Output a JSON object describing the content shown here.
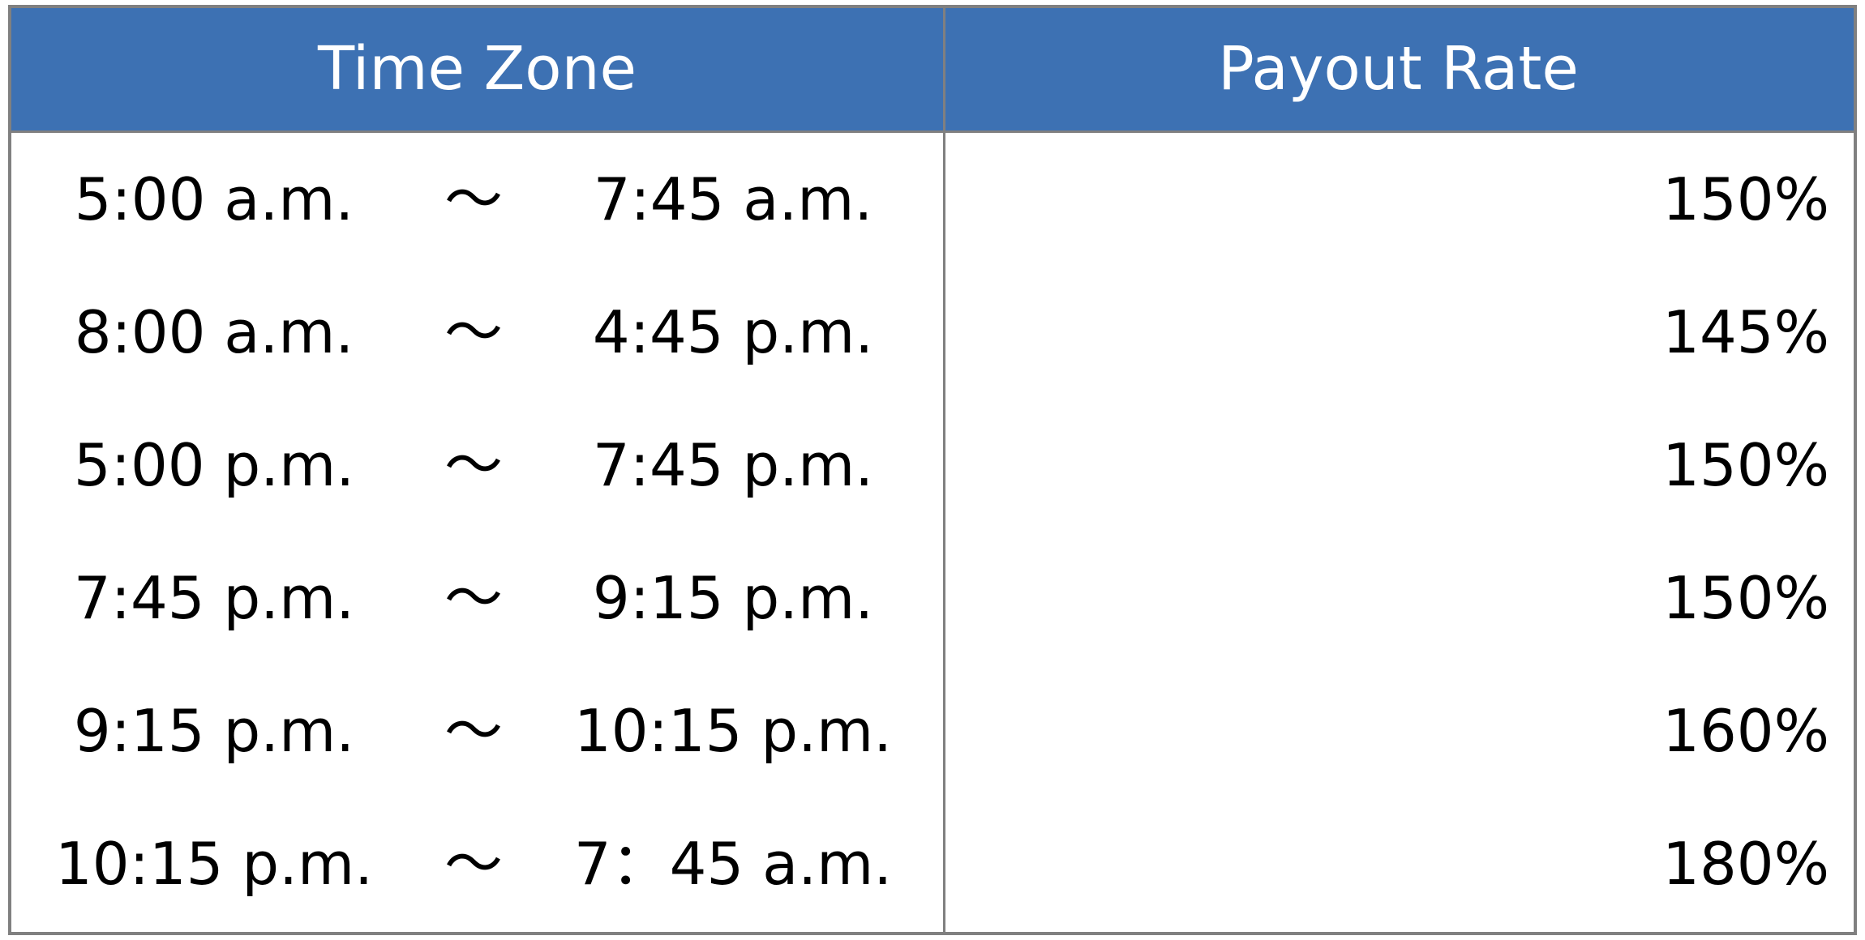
{
  "header": {
    "time_zone": "Time Zone",
    "payout_rate": "Payout Rate"
  },
  "rows": [
    {
      "start": "5:00 a.m.",
      "separator": "～",
      "end": "7:45 a.m.",
      "rate": "150%"
    },
    {
      "start": "8:00 a.m.",
      "separator": "～",
      "end": "4:45 p.m.",
      "rate": "145%"
    },
    {
      "start": "5:00 p.m.",
      "separator": "～",
      "end": "7:45 p.m.",
      "rate": "150%"
    },
    {
      "start": "7:45 p.m.",
      "separator": "～",
      "end": "9:15 p.m.",
      "rate": "150%"
    },
    {
      "start": "9:15 p.m.",
      "separator": "～",
      "end": "10:15 p.m.",
      "rate": "160%"
    },
    {
      "start": "10:15 p.m.",
      "separator": "～",
      "end": "7：45 a.m.",
      "rate": "180%"
    }
  ],
  "colors": {
    "header_background": "#3d71b3",
    "header_text": "#ffffff",
    "border": "#808080",
    "body_text": "#000000"
  }
}
